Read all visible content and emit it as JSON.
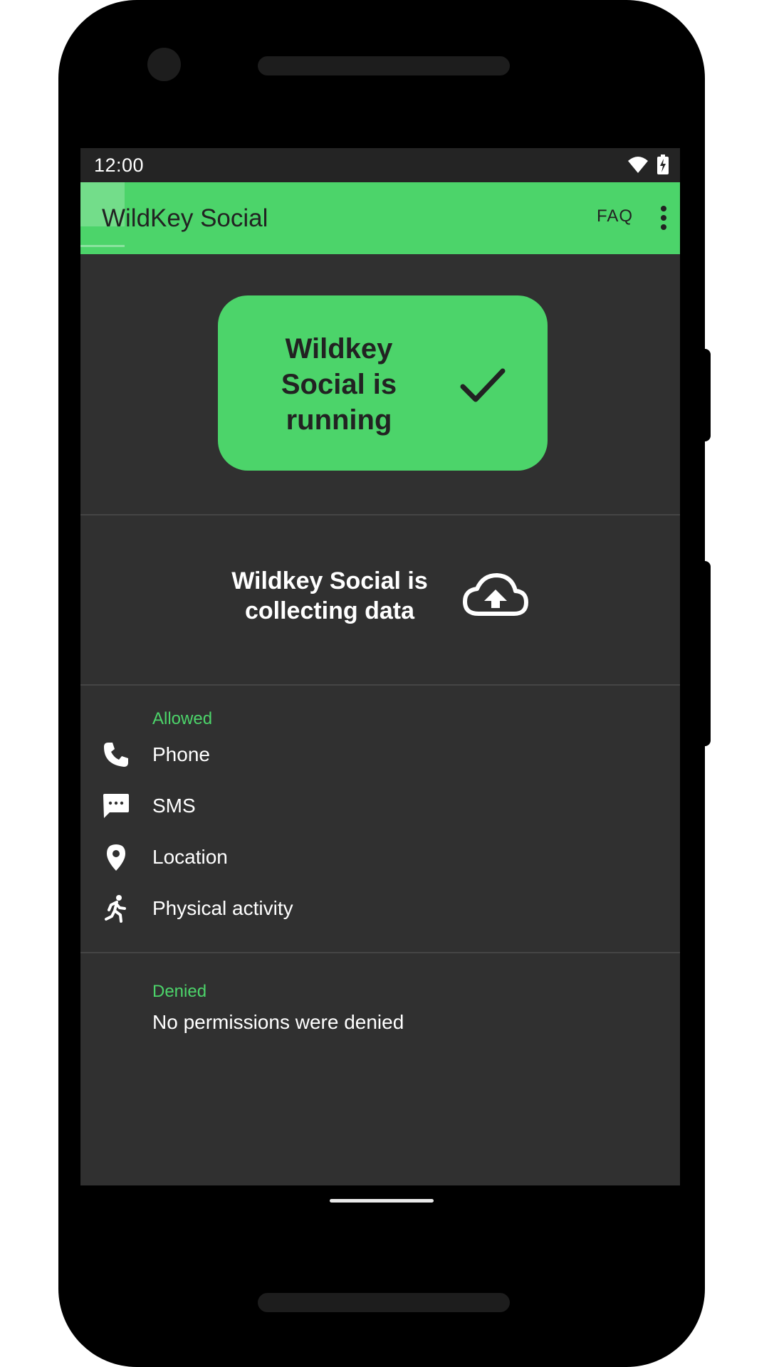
{
  "status_bar": {
    "time": "12:00",
    "icons": [
      "wifi-icon",
      "battery-charging-icon"
    ]
  },
  "app_bar": {
    "title": "WildKey Social",
    "faq_label": "FAQ",
    "menu_icon": "more-vert-icon"
  },
  "running_card": {
    "text": "Wildkey Social is running",
    "icon": "check-icon"
  },
  "collecting": {
    "text": "Wildkey Social is collecting data",
    "icon": "cloud-upload-icon"
  },
  "allowed": {
    "label": "Allowed",
    "items": [
      {
        "label": "Phone",
        "icon": "phone-icon"
      },
      {
        "label": "SMS",
        "icon": "sms-icon"
      },
      {
        "label": "Location",
        "icon": "location-icon"
      },
      {
        "label": "Physical activity",
        "icon": "running-icon"
      }
    ]
  },
  "denied": {
    "label": "Denied",
    "text": "No permissions were denied"
  },
  "colors": {
    "accent": "#4cd46a",
    "background": "#303030",
    "status_bar": "#242424"
  }
}
